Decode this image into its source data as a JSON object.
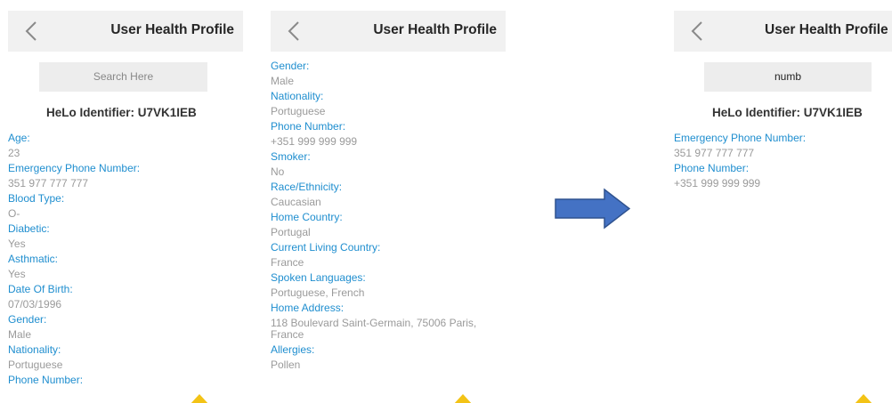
{
  "colors": {
    "header_bg": "#f1f1f1",
    "label": "#1f8ecf",
    "value": "#9a9a9a",
    "title": "#262626",
    "arrow": "#4472c4",
    "warning": "#f3c316"
  },
  "icons": {
    "back": "chevron-left-icon",
    "arrow": "arrow-right-icon",
    "warning": "warning-triangle-icon"
  },
  "screen1": {
    "title": "User Health Profile",
    "search_placeholder": "Search Here",
    "identifier": "HeLo Identifier: U7VK1IEB",
    "fields": [
      {
        "label": "Age:",
        "value": "23"
      },
      {
        "label": "Emergency Phone Number:",
        "value": "351 977 777 777"
      },
      {
        "label": "Blood Type:",
        "value": "O-"
      },
      {
        "label": "Diabetic:",
        "value": "Yes"
      },
      {
        "label": "Asthmatic:",
        "value": "Yes"
      },
      {
        "label": "Date Of Birth:",
        "value": "07/03/1996"
      },
      {
        "label": "Gender:",
        "value": "Male"
      },
      {
        "label": "Nationality:",
        "value": "Portuguese"
      },
      {
        "label": "Phone Number:",
        "value": ""
      }
    ]
  },
  "screen2": {
    "title": "User Health Profile",
    "fields": [
      {
        "label": "Gender:",
        "value": "Male"
      },
      {
        "label": "Nationality:",
        "value": "Portuguese"
      },
      {
        "label": "Phone Number:",
        "value": "+351 999 999 999"
      },
      {
        "label": "Smoker:",
        "value": "No"
      },
      {
        "label": "Race/Ethnicity:",
        "value": "Caucasian"
      },
      {
        "label": "Home Country:",
        "value": "Portugal"
      },
      {
        "label": "Current Living Country:",
        "value": "France"
      },
      {
        "label": "Spoken Languages:",
        "value": "Portuguese, French"
      },
      {
        "label": "Home Address:",
        "value": "118 Boulevard Saint-Germain, 75006 Paris, France"
      },
      {
        "label": "Allergies:",
        "value": "Pollen"
      }
    ]
  },
  "screen3": {
    "title": "User Health Profile",
    "search_value": "numb",
    "identifier": "HeLo Identifier: U7VK1IEB",
    "fields": [
      {
        "label": "Emergency Phone Number:",
        "value": "351 977 777 777"
      },
      {
        "label": "Phone Number:",
        "value": "+351 999 999 999"
      }
    ]
  }
}
